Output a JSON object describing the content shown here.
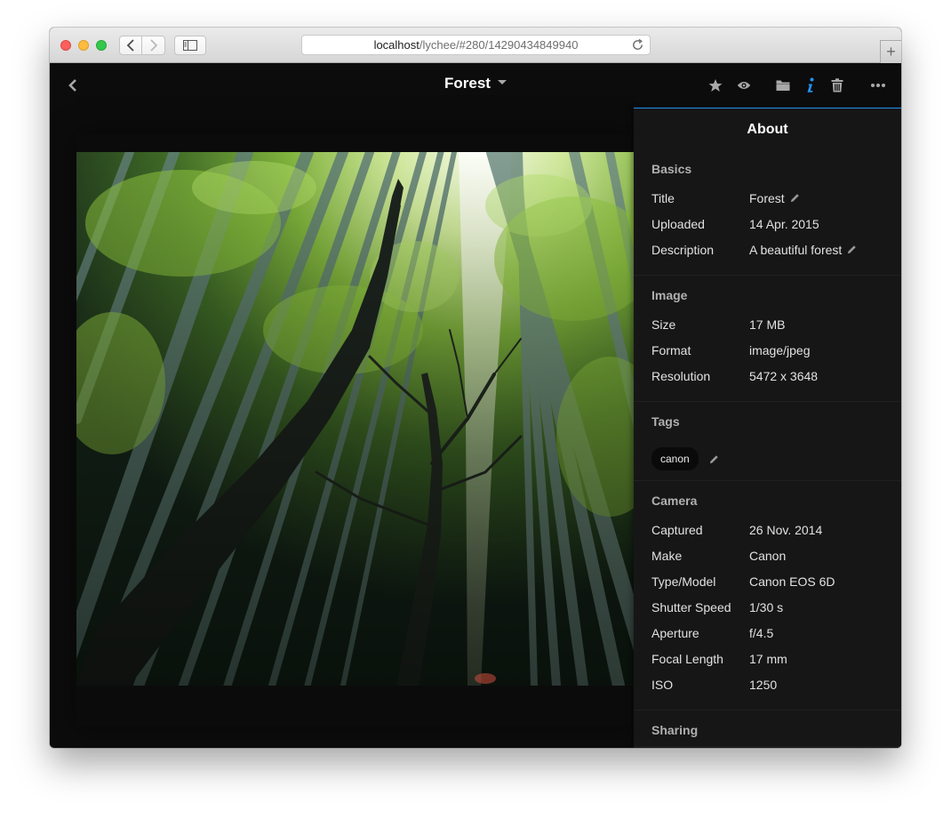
{
  "browser": {
    "url_host": "localhost",
    "url_path": "/lychee/#280/14290434849940"
  },
  "header": {
    "title": "Forest"
  },
  "sidebar": {
    "title": "About",
    "basics": {
      "heading": "Basics",
      "title_label": "Title",
      "title_value": "Forest",
      "uploaded_label": "Uploaded",
      "uploaded_value": "14 Apr. 2015",
      "description_label": "Description",
      "description_value": "A beautiful forest"
    },
    "image": {
      "heading": "Image",
      "size_label": "Size",
      "size_value": "17 MB",
      "format_label": "Format",
      "format_value": "image/jpeg",
      "resolution_label": "Resolution",
      "resolution_value": "5472 x 3648"
    },
    "tags": {
      "heading": "Tags",
      "items": [
        "canon"
      ]
    },
    "camera": {
      "heading": "Camera",
      "captured_label": "Captured",
      "captured_value": "26 Nov. 2014",
      "make_label": "Make",
      "make_value": "Canon",
      "model_label": "Type/Model",
      "model_value": "Canon EOS 6D",
      "shutter_label": "Shutter Speed",
      "shutter_value": "1/30 s",
      "aperture_label": "Aperture",
      "aperture_value": "f/4.5",
      "focal_label": "Focal Length",
      "focal_value": "17 mm",
      "iso_label": "ISO",
      "iso_value": "1250"
    },
    "sharing": {
      "heading": "Sharing"
    }
  },
  "icons": {
    "back": "chevron-left-icon",
    "star": "star-icon",
    "eye": "eye-icon",
    "folder": "folder-icon",
    "info": "info-icon",
    "trash": "trash-icon",
    "more": "more-icon",
    "edit": "pencil-icon"
  },
  "colors": {
    "accent": "#2293ec",
    "background": "#0c0c0d",
    "sidebar": "#161617"
  }
}
